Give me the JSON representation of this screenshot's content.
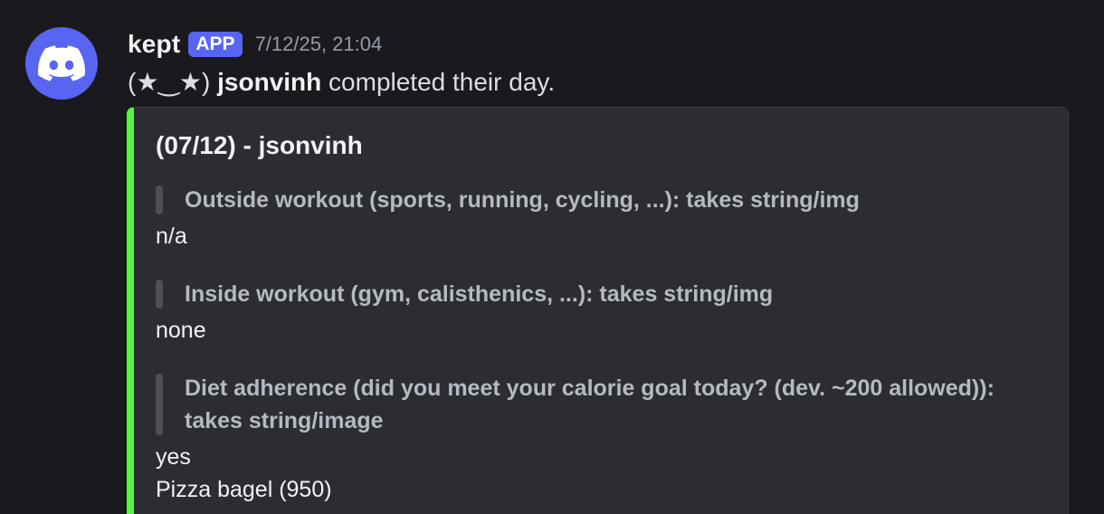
{
  "message": {
    "author": "kept",
    "badge": "APP",
    "timestamp": "7/12/25, 21:04",
    "content_prefix": "(★‿★)",
    "content_user": "jsonvinh",
    "content_suffix": "completed their day.",
    "avatar_icon": "discord-logo-icon"
  },
  "embed": {
    "accent_color": "#57f540",
    "title": "(07/12) - jsonvinh",
    "fields": [
      {
        "name": "Outside workout (sports, running, cycling, ...): takes string/img",
        "value": "n/a"
      },
      {
        "name": "Inside workout (gym, calisthenics, ...): takes string/img",
        "value": "none"
      },
      {
        "name_line1": "Diet adherence (did you meet your calorie goal today? (dev. ~200 allowed)):",
        "name_line2": "takes string/image",
        "value_line1": "yes",
        "value_line2": "Pizza bagel (950)"
      }
    ]
  }
}
